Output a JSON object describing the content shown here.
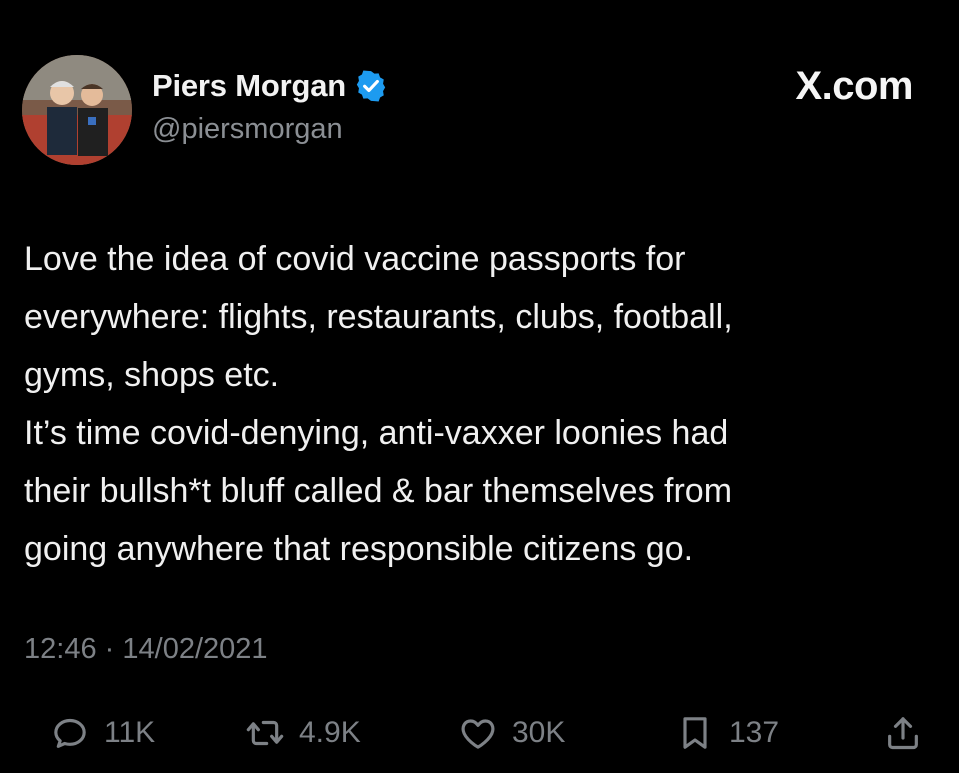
{
  "author": {
    "display_name": "Piers Morgan",
    "handle": "@piersmorgan",
    "verified": true,
    "verified_color": "#1d9bf0"
  },
  "brand": "X.com",
  "post": {
    "text": "Love the idea of covid vaccine passports for\neverywhere: flights, restaurants, clubs, football,\ngyms, shops etc.\nIt’s time covid-denying, anti-vaxxer loonies had\ntheir bullsh*t bluff called & bar themselves from\ngoing anywhere that responsible citizens go."
  },
  "meta": {
    "time": "12:46",
    "separator": "·",
    "date": "14/02/2021"
  },
  "actions": {
    "replies": {
      "icon": "reply-icon",
      "count": "11K"
    },
    "reposts": {
      "icon": "repost-icon",
      "count": "4.9K"
    },
    "likes": {
      "icon": "like-icon",
      "count": "30K"
    },
    "bookmarks": {
      "icon": "bookmark-icon",
      "count": "137"
    },
    "share": {
      "icon": "share-icon"
    }
  },
  "colors": {
    "background": "#000000",
    "primary_text": "#e7e9ea",
    "secondary_text": "#7d8186"
  }
}
